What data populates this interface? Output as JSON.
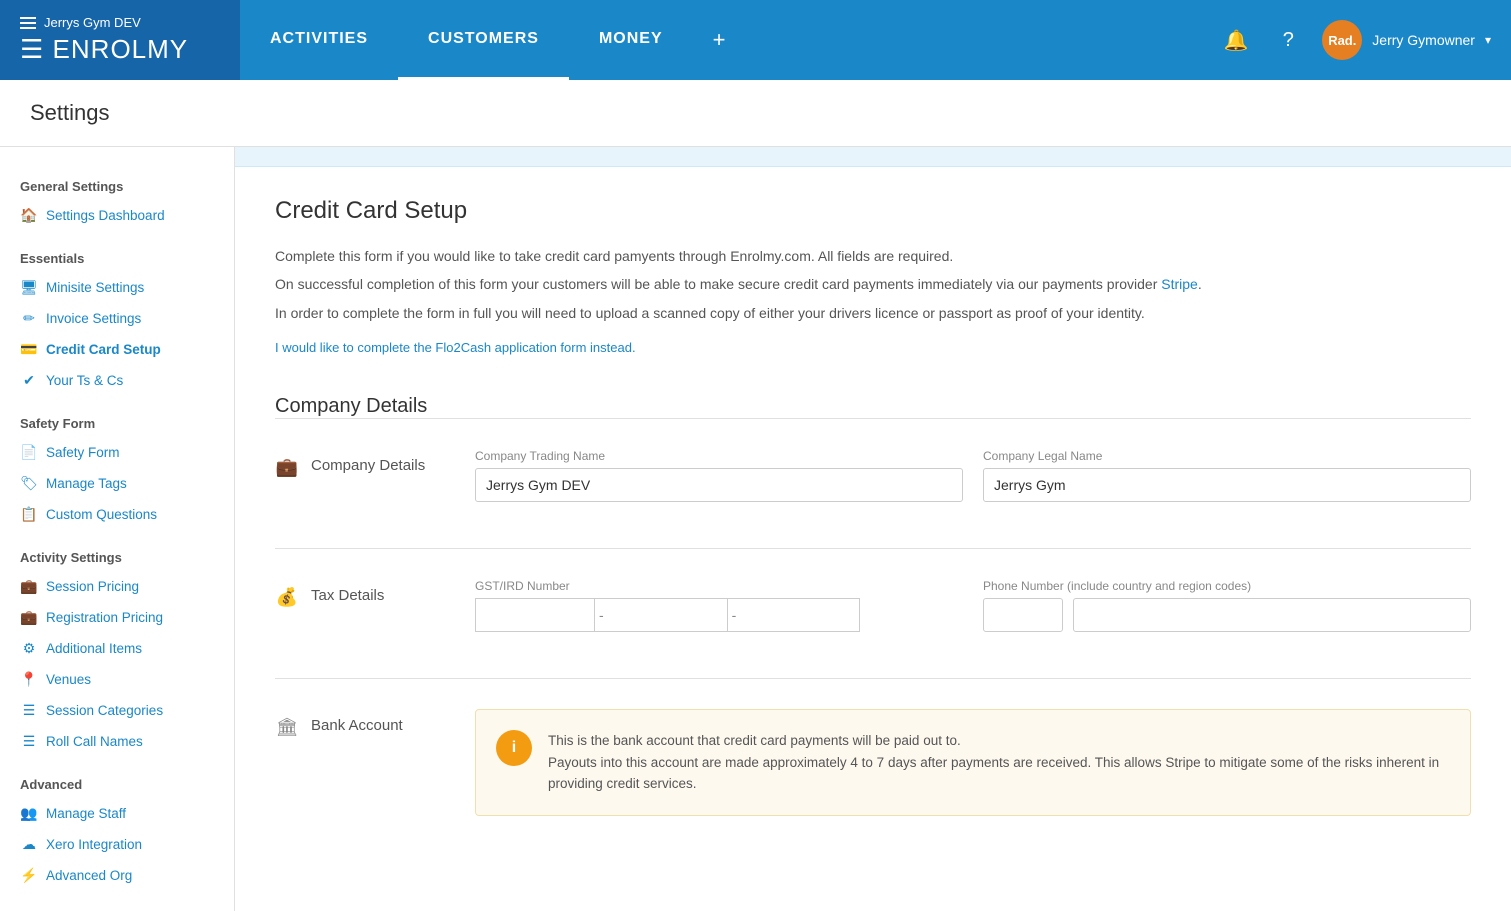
{
  "app": {
    "logo": "ENROLMY",
    "gym_name": "Jerrys Gym DEV"
  },
  "nav": {
    "tabs": [
      {
        "id": "activities",
        "label": "ACTIVITIES",
        "active": false
      },
      {
        "id": "customers",
        "label": "CUSTOMERS",
        "active": true
      },
      {
        "id": "money",
        "label": "MONEY",
        "active": false
      }
    ],
    "plus_label": "+",
    "bell_label": "🔔",
    "help_label": "?",
    "user": {
      "avatar_text": "Rad.",
      "name": "Jerry Gymowner"
    }
  },
  "page": {
    "title": "Settings"
  },
  "sidebar": {
    "general_settings_title": "General Settings",
    "settings_dashboard_label": "Settings Dashboard",
    "essentials_title": "Essentials",
    "items_essentials": [
      {
        "id": "minisite-settings",
        "label": "Minisite Settings",
        "icon": "🖥"
      },
      {
        "id": "invoice-settings",
        "label": "Invoice Settings",
        "icon": "✏"
      },
      {
        "id": "credit-card-setup",
        "label": "Credit Card Setup",
        "icon": "💳",
        "active": true
      },
      {
        "id": "your-ts-cs",
        "label": "Your Ts & Cs",
        "icon": "✔"
      }
    ],
    "safety_form_title": "Safety Form",
    "items_safety": [
      {
        "id": "safety-form",
        "label": "Safety Form",
        "icon": "📄"
      },
      {
        "id": "manage-tags",
        "label": "Manage Tags",
        "icon": "🏷"
      },
      {
        "id": "custom-questions",
        "label": "Custom Questions",
        "icon": "📋"
      }
    ],
    "activity_settings_title": "Activity Settings",
    "items_activity": [
      {
        "id": "session-pricing",
        "label": "Session Pricing",
        "icon": "💼"
      },
      {
        "id": "registration-pricing",
        "label": "Registration Pricing",
        "icon": "💼"
      },
      {
        "id": "additional-items",
        "label": "Additional Items",
        "icon": "⚙"
      },
      {
        "id": "venues",
        "label": "Venues",
        "icon": "📍"
      },
      {
        "id": "session-categories",
        "label": "Session Categories",
        "icon": "☰"
      },
      {
        "id": "roll-call-names",
        "label": "Roll Call Names",
        "icon": "☰"
      }
    ],
    "advanced_title": "Advanced",
    "items_advanced": [
      {
        "id": "manage-staff",
        "label": "Manage Staff",
        "icon": "👥"
      },
      {
        "id": "xero-integration",
        "label": "Xero Integration",
        "icon": "☁"
      },
      {
        "id": "advanced-org",
        "label": "Advanced Org",
        "icon": "⚡"
      }
    ]
  },
  "main": {
    "section_title": "Credit Card Setup",
    "intro_lines": [
      "Complete this form if you would like to take credit card pamyents through Enrolmy.com. All fields are required.",
      "On successful completion of this form your customers will be able to make secure credit card payments immediately via our payments provider Stripe.",
      "In order to complete the form in full you will need to upload a scanned copy of either your drivers licence or passport as proof of your identity."
    ],
    "stripe_link_text": "Stripe",
    "flo2cash_link": "I would like to complete the Flo2Cash application form instead.",
    "company_details_heading": "Company Details",
    "form_sections": {
      "company_details": {
        "label": "Company Details",
        "trading_name_label": "Company Trading Name",
        "trading_name_value": "Jerrys Gym DEV",
        "legal_name_label": "Company Legal Name",
        "legal_name_value": "Jerrys Gym",
        "gst_label": "GST/IRD Number",
        "phone_label": "Phone Number (include country and region codes)"
      },
      "tax_details": {
        "label": "Tax Details"
      },
      "bank_account": {
        "label": "Bank Account",
        "info_text": "This is the bank account that credit card payments will be paid out to.",
        "info_text2": "Payouts into this account are made approximately 4 to 7 days after payments are received. This allows Stripe to mitigate some of the risks inherent in providing credit services."
      }
    }
  }
}
